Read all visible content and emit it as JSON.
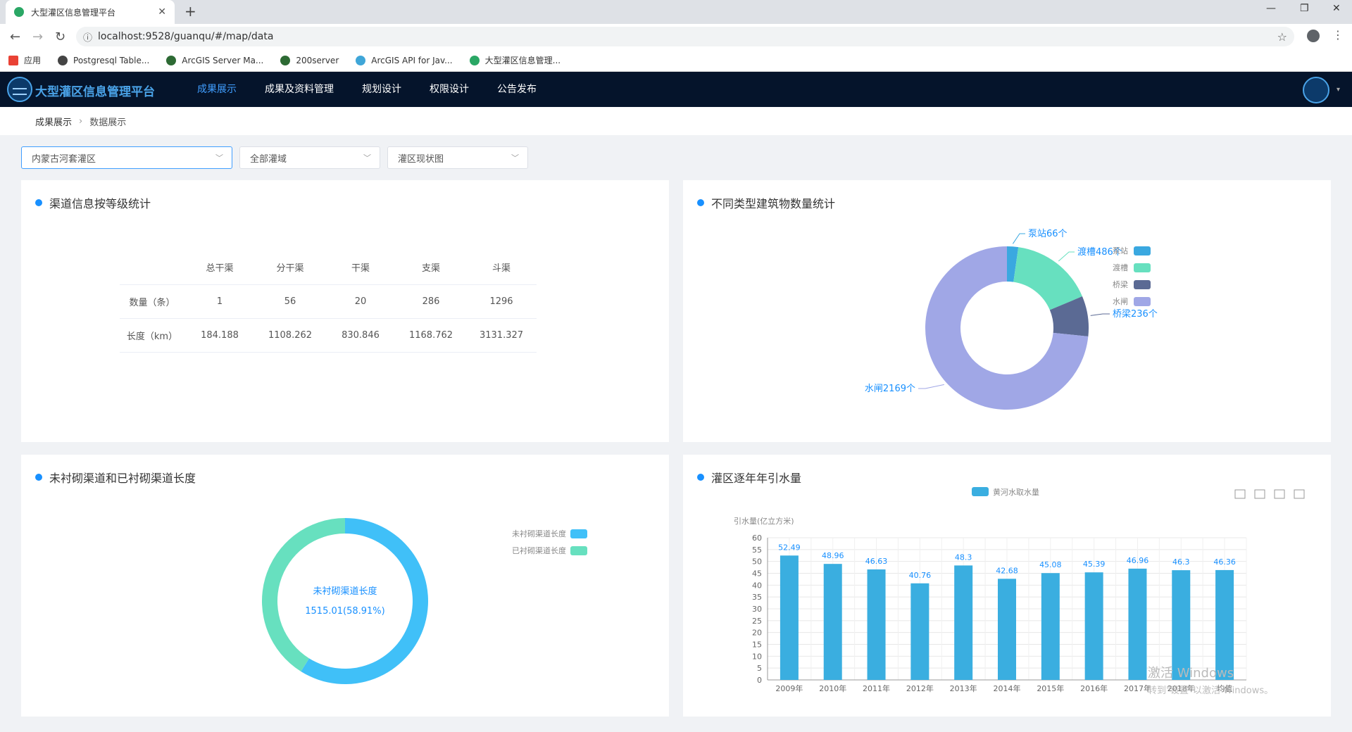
{
  "browser": {
    "tab_title": "大型灌区信息管理平台",
    "url": "localhost:9528/guanqu/#/map/data",
    "bookmarks": [
      "应用",
      "Postgresql Table...",
      "ArcGIS Server Ma...",
      "200server",
      "ArcGIS API for Jav...",
      "大型灌区信息管理..."
    ]
  },
  "app": {
    "title": "大型灌区信息管理平台",
    "nav": [
      "成果展示",
      "成果及资料管理",
      "规划设计",
      "权限设计",
      "公告发布"
    ],
    "active_nav": 0
  },
  "breadcrumb": [
    "成果展示",
    "数据展示"
  ],
  "filters": {
    "area": "内蒙古河套灌区",
    "domain": "全部灌域",
    "map": "灌区现状图"
  },
  "panel_channels": {
    "title": "渠道信息按等级统计",
    "headers": [
      "",
      "总干渠",
      "分干渠",
      "干渠",
      "支渠",
      "斗渠"
    ],
    "rows": [
      [
        "数量（条）",
        "1",
        "56",
        "20",
        "286",
        "1296"
      ],
      [
        "长度（km）",
        "184.188",
        "1108.262",
        "830.846",
        "1168.762",
        "3131.327"
      ]
    ]
  },
  "panel_buildings": {
    "title": "不同类型建筑物数量统计",
    "chart_data": {
      "type": "pie",
      "categories": [
        "泵站",
        "渡槽",
        "桥梁",
        "水闸"
      ],
      "values": [
        66,
        486,
        236,
        2169
      ],
      "labels": [
        "泵站66个",
        "渡槽486个",
        "桥梁236个",
        "水闸2169个"
      ],
      "colors": [
        "#3aa8e0",
        "#67e0bf",
        "#5b6a94",
        "#a0a7e6"
      ],
      "legend": "right"
    }
  },
  "panel_lining": {
    "title": "未衬砌渠道和已衬砌渠道长度",
    "center_label": "未衬砌渠道长度",
    "center_value": "1515.01(58.91%)",
    "legend": [
      "未衬砌渠道长度",
      "已衬砌渠道长度"
    ],
    "chart_data": {
      "type": "pie",
      "categories": [
        "未衬砌渠道长度",
        "已衬砌渠道长度"
      ],
      "percent": [
        58.91,
        41.09
      ],
      "colors": [
        "#40c0f8",
        "#67e0bf"
      ],
      "legend": "top-right"
    }
  },
  "panel_water": {
    "title": "灌区逐年年引水量",
    "chart_data": {
      "type": "bar",
      "categories": [
        "2009年",
        "2010年",
        "2011年",
        "2012年",
        "2013年",
        "2014年",
        "2015年",
        "2016年",
        "2017年",
        "2018年",
        "均值"
      ],
      "series": [
        {
          "name": "黄河水取水量",
          "values": [
            52.49,
            48.96,
            46.63,
            40.76,
            48.3,
            42.68,
            45.08,
            45.39,
            46.96,
            46.3,
            46.36
          ]
        }
      ],
      "ylabel": "引水量(亿立方米)",
      "ylim": [
        0,
        60
      ],
      "yticks": [
        0,
        5,
        10,
        15,
        20,
        25,
        30,
        35,
        40,
        45,
        50,
        55,
        60
      ],
      "grid": true,
      "color": "#3aaee0"
    }
  },
  "watermark": {
    "line1": "激活 Windows",
    "line2": "转到\"设置\"以激活 Windows。"
  }
}
